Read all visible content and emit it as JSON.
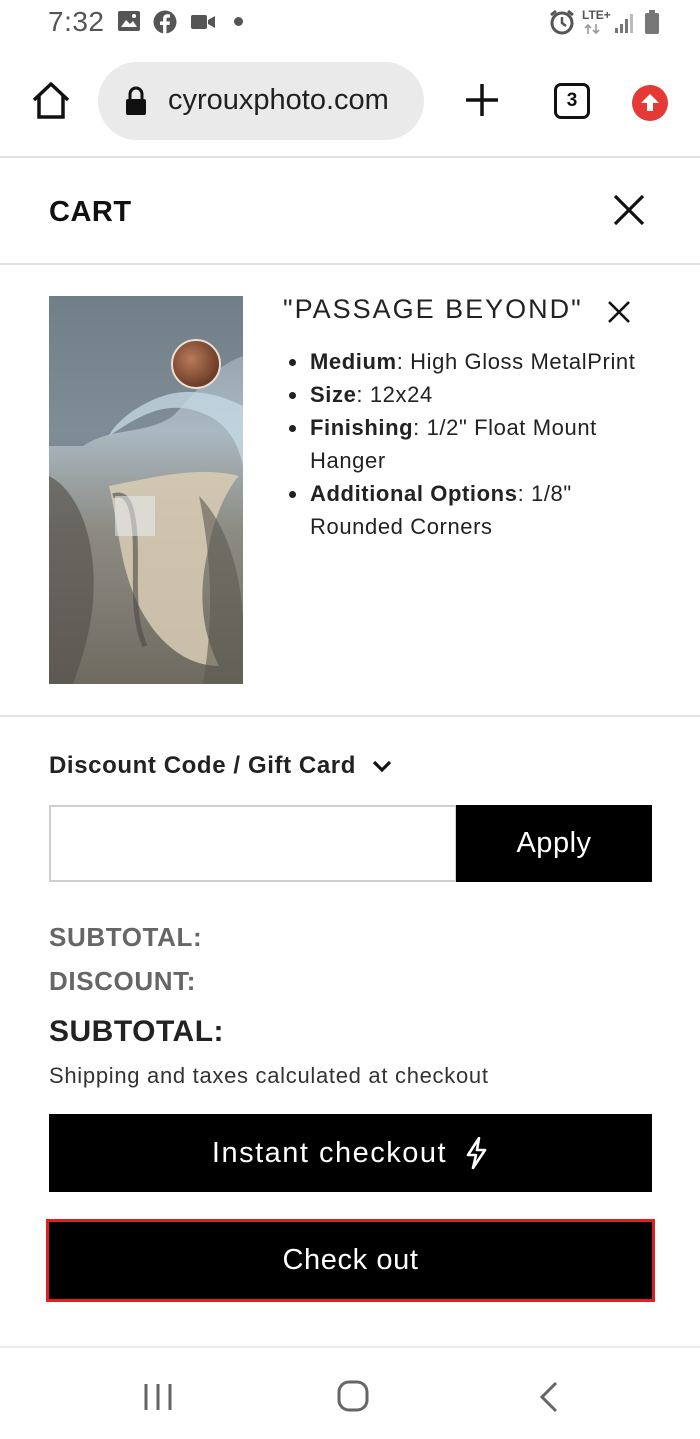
{
  "status_bar": {
    "time": "7:32",
    "network": "LTE+",
    "icons": [
      "image-icon",
      "facebook-icon",
      "video-icon",
      "alarm-icon",
      "signal-icon",
      "battery-icon"
    ]
  },
  "browser": {
    "url": "cyrouxphoto.com",
    "tab_count": "3"
  },
  "cart": {
    "title": "CART",
    "item": {
      "title": "\"PASSAGE BEYOND\"",
      "specs": [
        {
          "label": "Medium",
          "value": ": High Gloss MetalPrint"
        },
        {
          "label": "Size",
          "value": ": 12x24"
        },
        {
          "label": "Finishing",
          "value": ": 1/2\" Float Mount Hanger"
        },
        {
          "label": "Additional Options",
          "value": ": 1/8\" Rounded Corners"
        }
      ]
    },
    "discount": {
      "toggle_label": "Discount Code / Gift Card",
      "input_value": "",
      "apply_label": "Apply"
    },
    "summary": {
      "subtotal_label": "SUBTOTAL:",
      "discount_label": "DISCOUNT:",
      "total_label": "SUBTOTAL:",
      "shipping_note": "Shipping and taxes calculated at checkout"
    },
    "instant_checkout_label": "Instant checkout",
    "checkout_label": "Check out"
  },
  "colors": {
    "button_bg": "#000000",
    "checkout_outline": "#e02020",
    "update_badge": "#e53935"
  }
}
